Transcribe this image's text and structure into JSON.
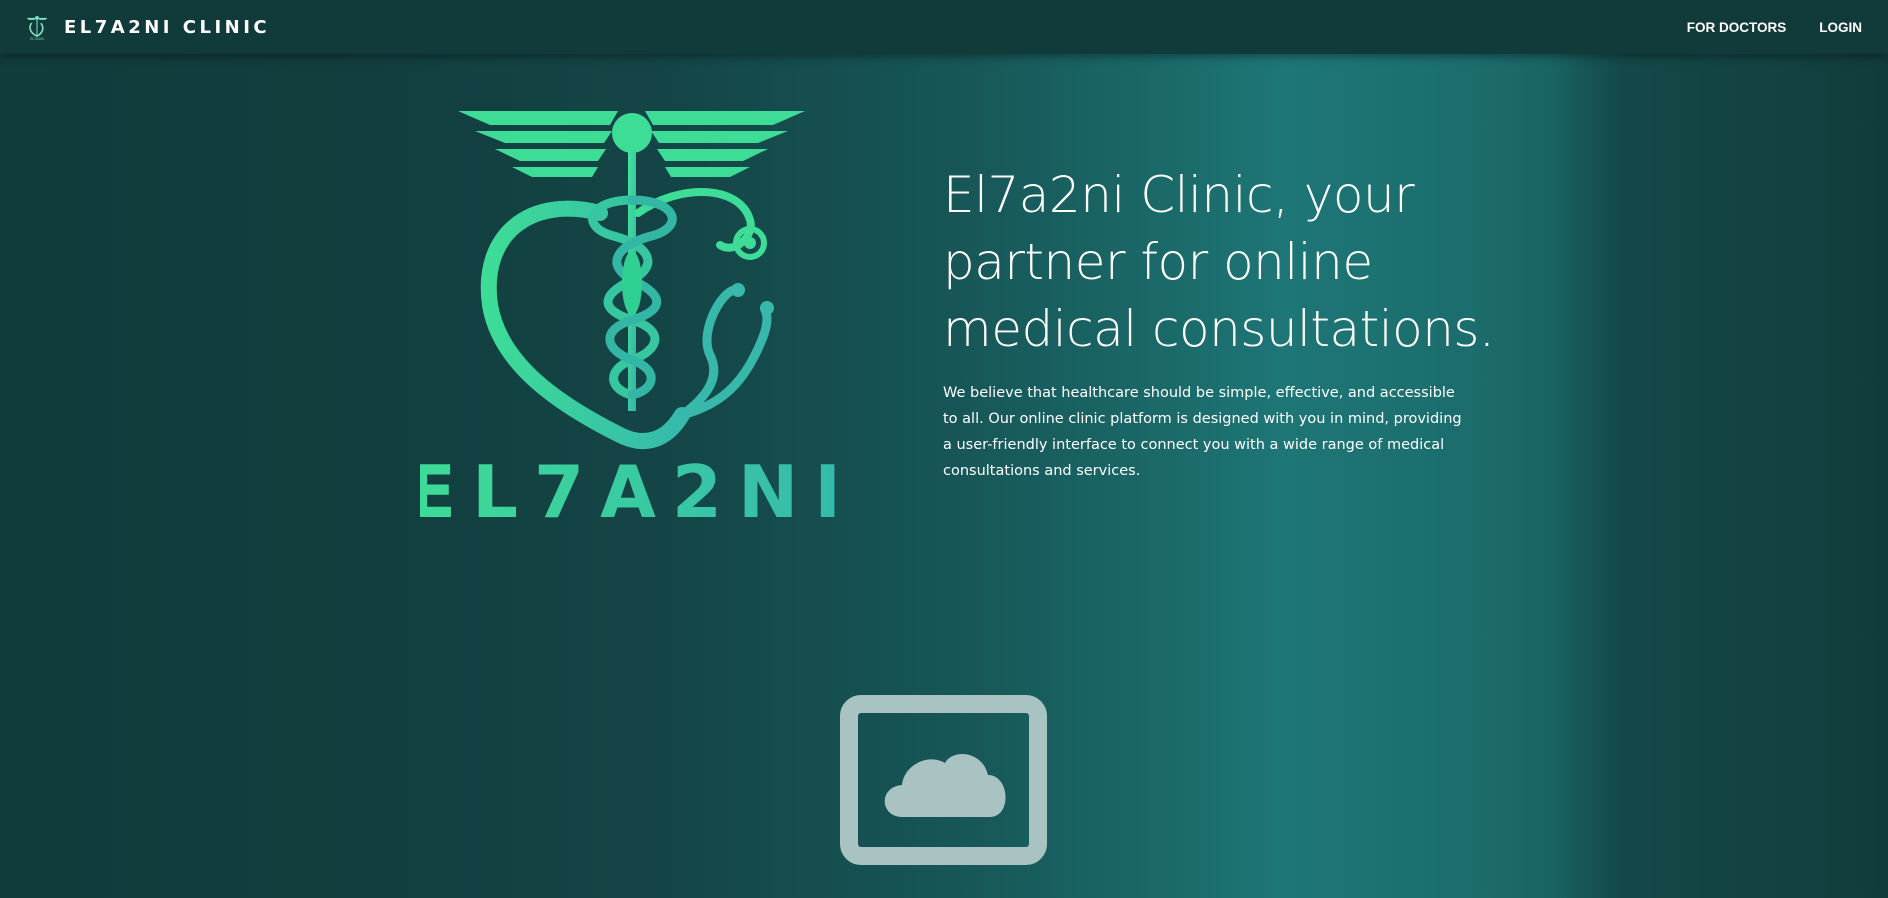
{
  "navbar": {
    "brand_logo_icon": "caduceus-heart-stethoscope-icon",
    "brand_name": "EL7A2NI CLINIC",
    "links": [
      {
        "label": "FOR DOCTORS"
      },
      {
        "label": "LOGIN"
      }
    ]
  },
  "hero": {
    "logo_icon": "caduceus-heart-stethoscope-logo",
    "logo_text": "EL7A2NI",
    "title": "El7a2ni Clinic, your partner for online medical consultations.",
    "description": "We believe that healthcare should be simple, effective, and accessible to all. Our online clinic platform is designed with you in mind, providing a user-friendly interface to connect you with a wide range of medical consultations and services."
  },
  "media": {
    "placeholder_icon": "image-placeholder-cloud-icon"
  },
  "colors": {
    "navbar_bg": "#113a3a",
    "background_dark": "#113c3c",
    "background_light": "#1e7676",
    "logo_green": "#3ddc97",
    "logo_teal": "#35b8a8",
    "placeholder_gray": "#a9c2c2"
  }
}
